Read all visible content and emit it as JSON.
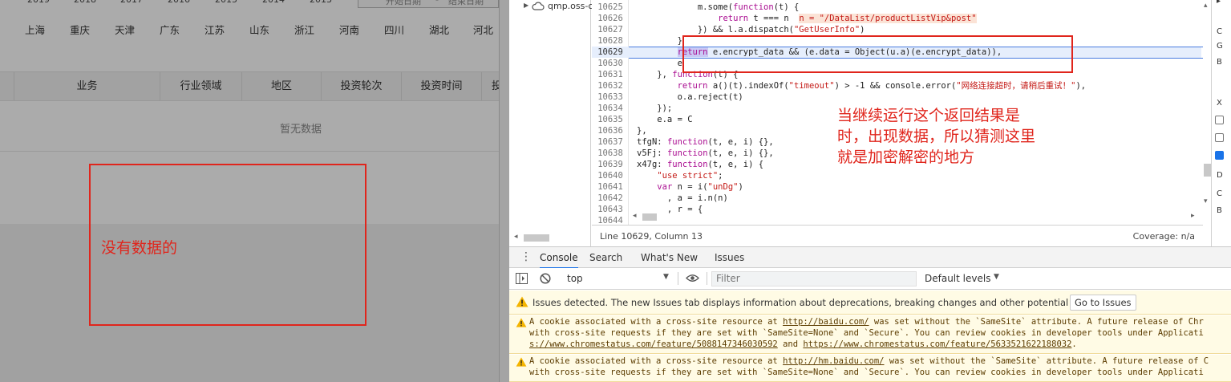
{
  "left_page": {
    "years": [
      "2019",
      "2018",
      "2017",
      "2016",
      "2015",
      "2014",
      "2013"
    ],
    "date_start_placeholder": "开始日期",
    "date_sep": "-",
    "date_end_placeholder": "结束日期",
    "regions": [
      "上海",
      "重庆",
      "天津",
      "广东",
      "江苏",
      "山东",
      "浙江",
      "河南",
      "四川",
      "湖北",
      "河北"
    ],
    "table_headers": [
      "业务",
      "行业领域",
      "地区",
      "投资轮次",
      "投资时间",
      "投"
    ],
    "empty_text": "暂无数据",
    "annotation": "没有数据的"
  },
  "devtools": {
    "navigator_item": "qmp.oss-c",
    "editor_lines": [
      {
        "n": "10625",
        "html": "            m.some(function(t) {"
      },
      {
        "n": "10626",
        "html": "                return t === n  n = \"/DataList/productListVip&post\""
      },
      {
        "n": "10627",
        "html": "            }) && l.a.dispatch(\"GetUserInfo\")"
      },
      {
        "n": "10628",
        "html": "        }"
      },
      {
        "n": "10629",
        "html": "        return e.encrypt_data && (e.data = Object(u.a)(e.encrypt_data)),"
      },
      {
        "n": "10630",
        "html": "        e"
      },
      {
        "n": "10631",
        "html": "    }, function(t) {"
      },
      {
        "n": "10632",
        "html": "        return a()(t).indexOf(\"timeout\") > -1 && console.error(\"网络连接超时，请稍后重试！\"),"
      },
      {
        "n": "10633",
        "html": "        o.a.reject(t)"
      },
      {
        "n": "10634",
        "html": "    });"
      },
      {
        "n": "10635",
        "html": "    e.a = C"
      },
      {
        "n": "10636",
        "html": "},"
      },
      {
        "n": "10637",
        "html": "tfgN: function(t, e, i) {},"
      },
      {
        "n": "10638",
        "html": "v5Fj: function(t, e, i) {},"
      },
      {
        "n": "10639",
        "html": "x47g: function(t, e, i) {"
      },
      {
        "n": "10640",
        "html": "    \"use strict\";"
      },
      {
        "n": "10641",
        "html": "    var n = i(\"unDg\")"
      },
      {
        "n": "10642",
        "html": "      , a = i.n(n)"
      },
      {
        "n": "10643",
        "html": "      , r = {"
      },
      {
        "n": "10644",
        "html": ""
      }
    ],
    "status_position": "Line 10629, Column 13",
    "status_coverage": "Coverage: n/a",
    "right_pane_letters": [
      "C",
      "G",
      "B",
      "X",
      "D",
      "C",
      "B"
    ],
    "annotation": "当继续运行这个返回结果是时，出现数据，所以猜测这里就是加密解密的地方",
    "drawer_tabs": [
      "Console",
      "Search",
      "What's New",
      "Issues"
    ],
    "context": "top",
    "filter_placeholder": "Filter",
    "levels": "Default levels",
    "issues_text": "Issues detected. The new Issues tab displays information about deprecations, breaking changes and other potential problems.",
    "issues_button": "Go to Issues",
    "messages": [
      {
        "l1_pre": "A cookie associated with a cross-site resource at ",
        "l1_link": "http://baidu.com/",
        "l1_post": " was set without the `SameSite` attribute. A future release of Chr",
        "l2": "with cross-site requests if they are set with `SameSite=None` and `Secure`. You can review cookies in developer tools under Applicati",
        "l3_link1": "s://www.chromestatus.com/feature/5088147346030592",
        "l3_mid": " and ",
        "l3_link2": "https://www.chromestatus.com/feature/5633521622188032",
        "l3_post": "."
      },
      {
        "l1_pre": "A cookie associated with a cross-site resource at ",
        "l1_link": "http://hm.baidu.com/",
        "l1_post": " was set without the `SameSite` attribute. A future release of C",
        "l2": "with cross-site requests if they are set with `SameSite=None` and `Secure`. You can review cookies in developer tools under Applicati"
      }
    ],
    "colors": {
      "annotation_red": "#e0251c",
      "warn_bg": "#fffbe5",
      "active_tab": "#1a73e8"
    }
  }
}
